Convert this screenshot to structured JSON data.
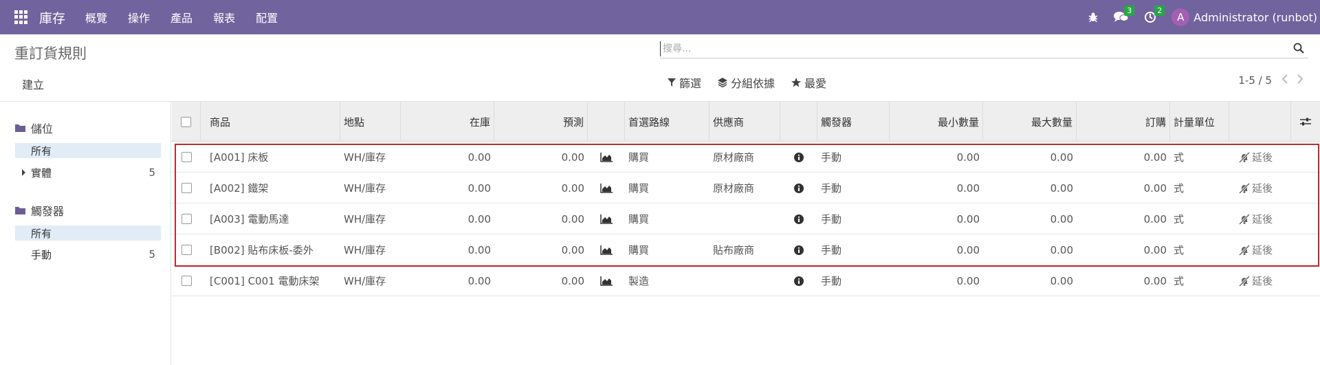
{
  "navbar": {
    "app_title": "庫存",
    "menu": [
      "概覽",
      "操作",
      "產品",
      "報表",
      "配置"
    ],
    "messages_count": "3",
    "activities_count": "2",
    "avatar_letter": "A",
    "user_name": "Administrator (runbot)",
    "bg_color": "#71639e"
  },
  "control": {
    "page_title": "重訂貨規則",
    "create_label": "建立",
    "search_placeholder": "搜尋...",
    "filter_label": "篩選",
    "group_label": "分組依據",
    "favorite_label": "最愛",
    "pager": "1-5 / 5"
  },
  "sidebar": {
    "section1": "儲位",
    "section1_items": [
      {
        "label": "所有",
        "count": ""
      },
      {
        "label": "實體",
        "count": "5"
      }
    ],
    "section2": "觸發器",
    "section2_items": [
      {
        "label": "所有",
        "count": ""
      },
      {
        "label": "手動",
        "count": "5"
      }
    ]
  },
  "table": {
    "headers": {
      "product": "商品",
      "location": "地點",
      "on_hand": "在庫",
      "forecast": "預測",
      "route": "首選路線",
      "vendor": "供應商",
      "trigger": "觸發器",
      "min_qty": "最小數量",
      "max_qty": "最大數量",
      "order": "訂購",
      "uom": "計量單位"
    },
    "rows": [
      {
        "product": "[A001] 床板",
        "location": "WH/庫存",
        "on_hand": "0.00",
        "forecast": "0.00",
        "route": "購買",
        "vendor": "原材廠商",
        "trigger": "手動",
        "min_qty": "0.00",
        "max_qty": "0.00",
        "order": "0.00",
        "uom": "式",
        "action": "延後"
      },
      {
        "product": "[A002] 鐵架",
        "location": "WH/庫存",
        "on_hand": "0.00",
        "forecast": "0.00",
        "route": "購買",
        "vendor": "原材廠商",
        "trigger": "手動",
        "min_qty": "0.00",
        "max_qty": "0.00",
        "order": "0.00",
        "uom": "式",
        "action": "延後"
      },
      {
        "product": "[A003] 電動馬達",
        "location": "WH/庫存",
        "on_hand": "0.00",
        "forecast": "0.00",
        "route": "購買",
        "vendor": "",
        "trigger": "手動",
        "min_qty": "0.00",
        "max_qty": "0.00",
        "order": "0.00",
        "uom": "式",
        "action": "延後"
      },
      {
        "product": "[B002] 貼布床板-委外",
        "location": "WH/庫存",
        "on_hand": "0.00",
        "forecast": "0.00",
        "route": "購買",
        "vendor": "貼布廠商",
        "trigger": "手動",
        "min_qty": "0.00",
        "max_qty": "0.00",
        "order": "0.00",
        "uom": "式",
        "action": "延後"
      },
      {
        "product": "[C001] C001 電動床架",
        "location": "WH/庫存",
        "on_hand": "0.00",
        "forecast": "0.00",
        "route": "製造",
        "vendor": "",
        "trigger": "手動",
        "min_qty": "0.00",
        "max_qty": "0.00",
        "order": "0.00",
        "uom": "式",
        "action": "延後"
      }
    ]
  },
  "colors": {
    "highlight_border": "#c0282d",
    "active_filter_bg": "#e1ecf7",
    "badge_green": "#28a745"
  }
}
